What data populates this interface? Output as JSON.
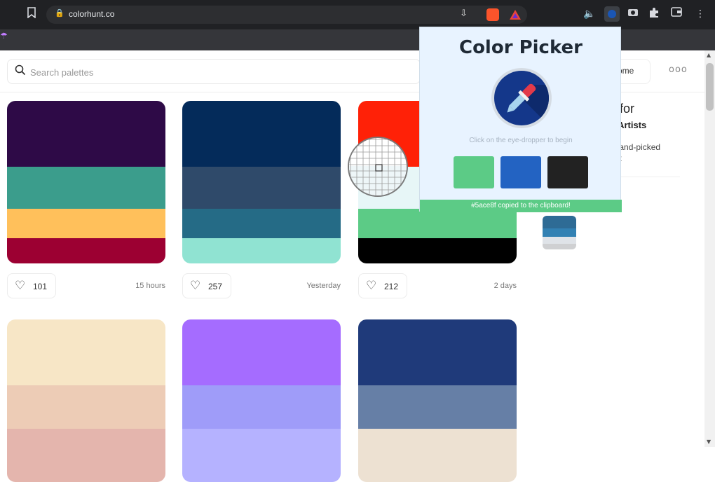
{
  "browser": {
    "url": "colorhunt.co",
    "icons": {
      "bookmark": "bookmark-icon",
      "lock": "lock-icon",
      "menu": "kebab-menu-icon"
    }
  },
  "site": {
    "search_placeholder": "Search palettes",
    "home_label": "ome",
    "more_label": "ooo",
    "sidebar": {
      "title": "s for",
      "subtitle": "d Artists",
      "desc_line1": "t hand-picked",
      "desc_line2": "ant"
    }
  },
  "palettes": [
    {
      "colors": [
        "#2e0a47",
        "#3b9d8c",
        "#ffc05b",
        "#9c0032"
      ],
      "likes": "101",
      "time": "15 hours"
    },
    {
      "colors": [
        "#042b5a",
        "#2f4a6a",
        "#256b86",
        "#90e3d2"
      ],
      "likes": "257",
      "time": "Yesterday"
    },
    {
      "colors": [
        "#ff2107",
        "#e7f6f7",
        "#5ccb86",
        "#000000"
      ],
      "likes": "212",
      "time": "2 days"
    },
    {
      "colors": [
        "#f7e6c6",
        "#edccb6",
        "#e4b5ad"
      ]
    },
    {
      "colors": [
        "#a56cff",
        "#9f9cf9",
        "#b5b2ff"
      ]
    },
    {
      "colors": [
        "#1f3a7a",
        "#667fa6",
        "#ede1d2"
      ]
    }
  ],
  "mini_palette": [
    "#2e6b95",
    "#3281b3",
    "#dfe3e8",
    "#cfd0d2"
  ],
  "popup": {
    "title": "Color Picker",
    "hint": "Click on the eye-dropper to begin",
    "status": "#5ace8f copied to the clipboard!",
    "swatches": [
      "#5ccb86",
      "#2363c2",
      "#222222"
    ]
  }
}
